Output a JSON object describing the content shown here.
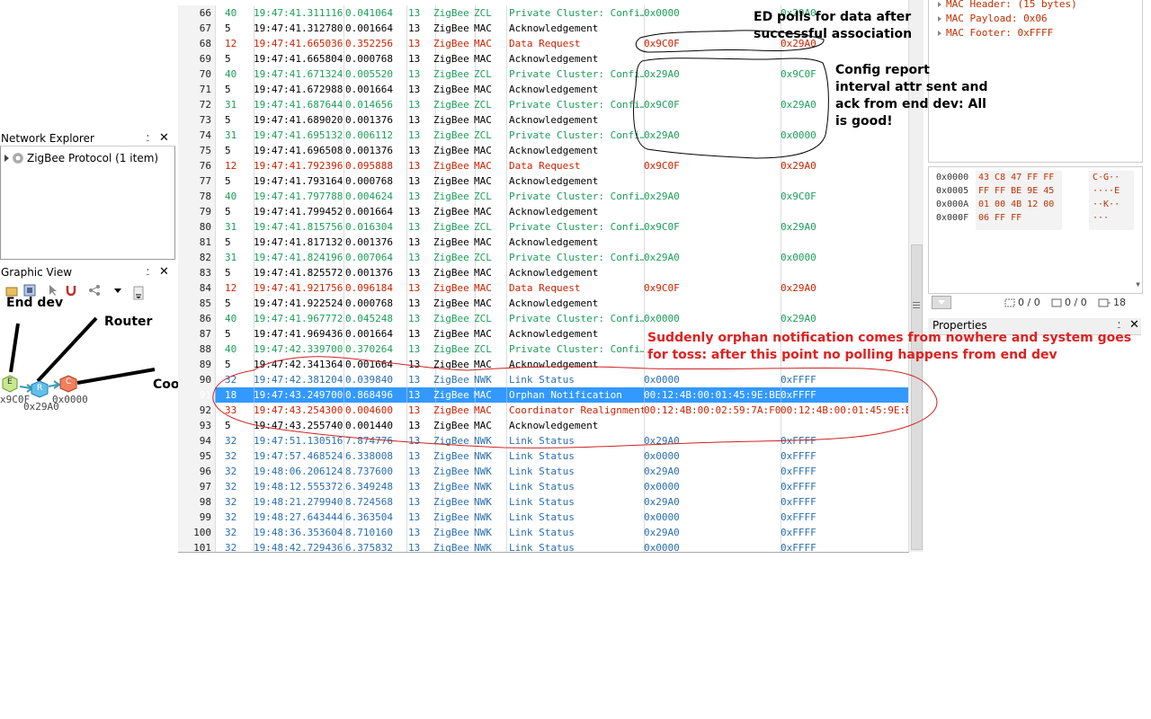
{
  "network_explorer": {
    "title": "Network Explorer",
    "pin": "⍘",
    "close": "✕",
    "item": "ZigBee Protocol (1 item)"
  },
  "graphic_view": {
    "title": "Graphic View",
    "pin": "⍘",
    "close": "✕"
  },
  "graph_labels": {
    "end_dev": "End dev",
    "router": "Router",
    "coord": "Coord",
    "e_letter": "E",
    "r_letter": "R",
    "c_letter": "C",
    "e_addr": "x9C0F",
    "r_addr": "0x29A0",
    "c_addr": "0x0000"
  },
  "rows": [
    {
      "n": "66",
      "t": "40",
      "time": "19:47:41.311116",
      "d": "0.041064",
      "ch": "13",
      "p": "ZigBee",
      "l": "ZCL",
      "info": "Private Cluster: Confi…",
      "src": "0x0000",
      "dst": "0x29A0",
      "k": "zcl"
    },
    {
      "n": "67",
      "t": "5",
      "time": "19:47:41.312780",
      "d": "0.001664",
      "ch": "13",
      "p": "ZigBee",
      "l": "MAC",
      "info": "Acknowledgement",
      "src": "",
      "dst": "",
      "k": "mac"
    },
    {
      "n": "68",
      "t": "12",
      "time": "19:47:41.665036",
      "d": "0.352256",
      "ch": "13",
      "p": "ZigBee",
      "l": "MAC",
      "info": "Data Request",
      "src": "0x9C0F",
      "dst": "0x29A0",
      "k": "req"
    },
    {
      "n": "69",
      "t": "5",
      "time": "19:47:41.665804",
      "d": "0.000768",
      "ch": "13",
      "p": "ZigBee",
      "l": "MAC",
      "info": "Acknowledgement",
      "src": "",
      "dst": "",
      "k": "mac"
    },
    {
      "n": "70",
      "t": "40",
      "time": "19:47:41.671324",
      "d": "0.005520",
      "ch": "13",
      "p": "ZigBee",
      "l": "ZCL",
      "info": "Private Cluster: Confi…",
      "src": "0x29A0",
      "dst": "0x9C0F",
      "k": "zcl"
    },
    {
      "n": "71",
      "t": "5",
      "time": "19:47:41.672988",
      "d": "0.001664",
      "ch": "13",
      "p": "ZigBee",
      "l": "MAC",
      "info": "Acknowledgement",
      "src": "",
      "dst": "",
      "k": "mac"
    },
    {
      "n": "72",
      "t": "31",
      "time": "19:47:41.687644",
      "d": "0.014656",
      "ch": "13",
      "p": "ZigBee",
      "l": "ZCL",
      "info": "Private Cluster: Confi…",
      "src": "0x9C0F",
      "dst": "0x29A0",
      "k": "zcl"
    },
    {
      "n": "73",
      "t": "5",
      "time": "19:47:41.689020",
      "d": "0.001376",
      "ch": "13",
      "p": "ZigBee",
      "l": "MAC",
      "info": "Acknowledgement",
      "src": "",
      "dst": "",
      "k": "mac"
    },
    {
      "n": "74",
      "t": "31",
      "time": "19:47:41.695132",
      "d": "0.006112",
      "ch": "13",
      "p": "ZigBee",
      "l": "ZCL",
      "info": "Private Cluster: Confi…",
      "src": "0x29A0",
      "dst": "0x0000",
      "k": "zcl"
    },
    {
      "n": "75",
      "t": "5",
      "time": "19:47:41.696508",
      "d": "0.001376",
      "ch": "13",
      "p": "ZigBee",
      "l": "MAC",
      "info": "Acknowledgement",
      "src": "",
      "dst": "",
      "k": "mac"
    },
    {
      "n": "76",
      "t": "12",
      "time": "19:47:41.792396",
      "d": "0.095888",
      "ch": "13",
      "p": "ZigBee",
      "l": "MAC",
      "info": "Data Request",
      "src": "0x9C0F",
      "dst": "0x29A0",
      "k": "req"
    },
    {
      "n": "77",
      "t": "5",
      "time": "19:47:41.793164",
      "d": "0.000768",
      "ch": "13",
      "p": "ZigBee",
      "l": "MAC",
      "info": "Acknowledgement",
      "src": "",
      "dst": "",
      "k": "mac"
    },
    {
      "n": "78",
      "t": "40",
      "time": "19:47:41.797788",
      "d": "0.004624",
      "ch": "13",
      "p": "ZigBee",
      "l": "ZCL",
      "info": "Private Cluster: Confi…",
      "src": "0x29A0",
      "dst": "0x9C0F",
      "k": "zcl"
    },
    {
      "n": "79",
      "t": "5",
      "time": "19:47:41.799452",
      "d": "0.001664",
      "ch": "13",
      "p": "ZigBee",
      "l": "MAC",
      "info": "Acknowledgement",
      "src": "",
      "dst": "",
      "k": "mac"
    },
    {
      "n": "80",
      "t": "31",
      "time": "19:47:41.815756",
      "d": "0.016304",
      "ch": "13",
      "p": "ZigBee",
      "l": "ZCL",
      "info": "Private Cluster: Confi…",
      "src": "0x9C0F",
      "dst": "0x29A0",
      "k": "zcl"
    },
    {
      "n": "81",
      "t": "5",
      "time": "19:47:41.817132",
      "d": "0.001376",
      "ch": "13",
      "p": "ZigBee",
      "l": "MAC",
      "info": "Acknowledgement",
      "src": "",
      "dst": "",
      "k": "mac"
    },
    {
      "n": "82",
      "t": "31",
      "time": "19:47:41.824196",
      "d": "0.007064",
      "ch": "13",
      "p": "ZigBee",
      "l": "ZCL",
      "info": "Private Cluster: Confi…",
      "src": "0x29A0",
      "dst": "0x0000",
      "k": "zcl"
    },
    {
      "n": "83",
      "t": "5",
      "time": "19:47:41.825572",
      "d": "0.001376",
      "ch": "13",
      "p": "ZigBee",
      "l": "MAC",
      "info": "Acknowledgement",
      "src": "",
      "dst": "",
      "k": "mac"
    },
    {
      "n": "84",
      "t": "12",
      "time": "19:47:41.921756",
      "d": "0.096184",
      "ch": "13",
      "p": "ZigBee",
      "l": "MAC",
      "info": "Data Request",
      "src": "0x9C0F",
      "dst": "0x29A0",
      "k": "req"
    },
    {
      "n": "85",
      "t": "5",
      "time": "19:47:41.922524",
      "d": "0.000768",
      "ch": "13",
      "p": "ZigBee",
      "l": "MAC",
      "info": "Acknowledgement",
      "src": "",
      "dst": "",
      "k": "mac"
    },
    {
      "n": "86",
      "t": "40",
      "time": "19:47:41.967772",
      "d": "0.045248",
      "ch": "13",
      "p": "ZigBee",
      "l": "ZCL",
      "info": "Private Cluster: Confi…",
      "src": "0x0000",
      "dst": "0x29A0",
      "k": "zcl"
    },
    {
      "n": "87",
      "t": "5",
      "time": "19:47:41.969436",
      "d": "0.001664",
      "ch": "13",
      "p": "ZigBee",
      "l": "MAC",
      "info": "Acknowledgement",
      "src": "",
      "dst": "",
      "k": "mac"
    },
    {
      "n": "88",
      "t": "40",
      "time": "19:47:42.339700",
      "d": "0.370264",
      "ch": "13",
      "p": "ZigBee",
      "l": "ZCL",
      "info": "Private Cluster: Confi…",
      "src": "",
      "dst": "",
      "k": "zcl"
    },
    {
      "n": "89",
      "t": "5",
      "time": "19:47:42.341364",
      "d": "0.001664",
      "ch": "13",
      "p": "ZigBee",
      "l": "MAC",
      "info": "Acknowledgement",
      "src": "",
      "dst": "",
      "k": "mac"
    },
    {
      "n": "90",
      "t": "32",
      "time": "19:47:42.381204",
      "d": "0.039840",
      "ch": "13",
      "p": "ZigBee",
      "l": "NWK",
      "info": "Link Status",
      "src": "0x0000",
      "dst": "0xFFFF",
      "k": "nwk"
    },
    {
      "n": "91",
      "t": "18",
      "time": "19:47:43.249700",
      "d": "0.868496",
      "ch": "13",
      "p": "ZigBee",
      "l": "MAC",
      "info": "Orphan Notification",
      "src": "00:12:4B:00:01:45:9E:BE",
      "dst": "0xFFFF",
      "k": "mac",
      "sel": true
    },
    {
      "n": "92",
      "t": "33",
      "time": "19:47:43.254300",
      "d": "0.004600",
      "ch": "13",
      "p": "ZigBee",
      "l": "MAC",
      "info": "Coordinator Realignment",
      "src": "00:12:4B:00:02:59:7A:F0",
      "dst": "00:12:4B:00:01:45:9E:BE",
      "k": "coo"
    },
    {
      "n": "93",
      "t": "5",
      "time": "19:47:43.255740",
      "d": "0.001440",
      "ch": "13",
      "p": "ZigBee",
      "l": "MAC",
      "info": "Acknowledgement",
      "src": "",
      "dst": "",
      "k": "mac"
    },
    {
      "n": "94",
      "t": "32",
      "time": "19:47:51.130516",
      "d": "7.874776",
      "ch": "13",
      "p": "ZigBee",
      "l": "NWK",
      "info": "Link Status",
      "src": "0x29A0",
      "dst": "0xFFFF",
      "k": "nwk"
    },
    {
      "n": "95",
      "t": "32",
      "time": "19:47:57.468524",
      "d": "6.338008",
      "ch": "13",
      "p": "ZigBee",
      "l": "NWK",
      "info": "Link Status",
      "src": "0x0000",
      "dst": "0xFFFF",
      "k": "nwk"
    },
    {
      "n": "96",
      "t": "32",
      "time": "19:48:06.206124",
      "d": "8.737600",
      "ch": "13",
      "p": "ZigBee",
      "l": "NWK",
      "info": "Link Status",
      "src": "0x29A0",
      "dst": "0xFFFF",
      "k": "nwk"
    },
    {
      "n": "97",
      "t": "32",
      "time": "19:48:12.555372",
      "d": "6.349248",
      "ch": "13",
      "p": "ZigBee",
      "l": "NWK",
      "info": "Link Status",
      "src": "0x0000",
      "dst": "0xFFFF",
      "k": "nwk"
    },
    {
      "n": "98",
      "t": "32",
      "time": "19:48:21.279940",
      "d": "8.724568",
      "ch": "13",
      "p": "ZigBee",
      "l": "NWK",
      "info": "Link Status",
      "src": "0x29A0",
      "dst": "0xFFFF",
      "k": "nwk"
    },
    {
      "n": "99",
      "t": "32",
      "time": "19:48:27.643444",
      "d": "6.363504",
      "ch": "13",
      "p": "ZigBee",
      "l": "NWK",
      "info": "Link Status",
      "src": "0x0000",
      "dst": "0xFFFF",
      "k": "nwk"
    },
    {
      "n": "100",
      "t": "32",
      "time": "19:48:36.353604",
      "d": "8.710160",
      "ch": "13",
      "p": "ZigBee",
      "l": "NWK",
      "info": "Link Status",
      "src": "0x29A0",
      "dst": "0xFFFF",
      "k": "nwk"
    },
    {
      "n": "101",
      "t": "32",
      "time": "19:48:42.729436",
      "d": "6.375832",
      "ch": "13",
      "p": "ZigBee",
      "l": "NWK",
      "info": "Link Status",
      "src": "0x0000",
      "dst": "0xFFFF",
      "k": "nwk"
    }
  ],
  "tree": [
    "MAC Header: (15 bytes)",
    "MAC Payload: 0x06",
    "MAC Footer: 0xFFFF"
  ],
  "hex": [
    {
      "off": "0x0000",
      "bytes": "43 C8 47 FF FF",
      "ascii": "C·G··"
    },
    {
      "off": "0x0005",
      "bytes": "FF FF BE 9E 45",
      "ascii": "····E"
    },
    {
      "off": "0x000A",
      "bytes": "01 00 4B 12 00",
      "ascii": "··K··"
    },
    {
      "off": "0x000F",
      "bytes": "06 FF FF",
      "ascii": "···"
    }
  ],
  "hexbar": {
    "a": "0 / 0",
    "b": "0 / 0",
    "c": "18"
  },
  "properties": {
    "title": "Properties"
  },
  "annotations": {
    "a1": "ED polls for data after successful association",
    "a2": "Config report interval attr sent and ack from end dev: All is good!",
    "a3": "Suddenly orphan notification comes from nowhere and system goes for toss: after this point no polling happens from end dev"
  },
  "colors": {
    "zcl": "#1d9e5a",
    "req": "#cc2200",
    "nwk": "#2a6fb0",
    "sel": "#3399ff"
  }
}
